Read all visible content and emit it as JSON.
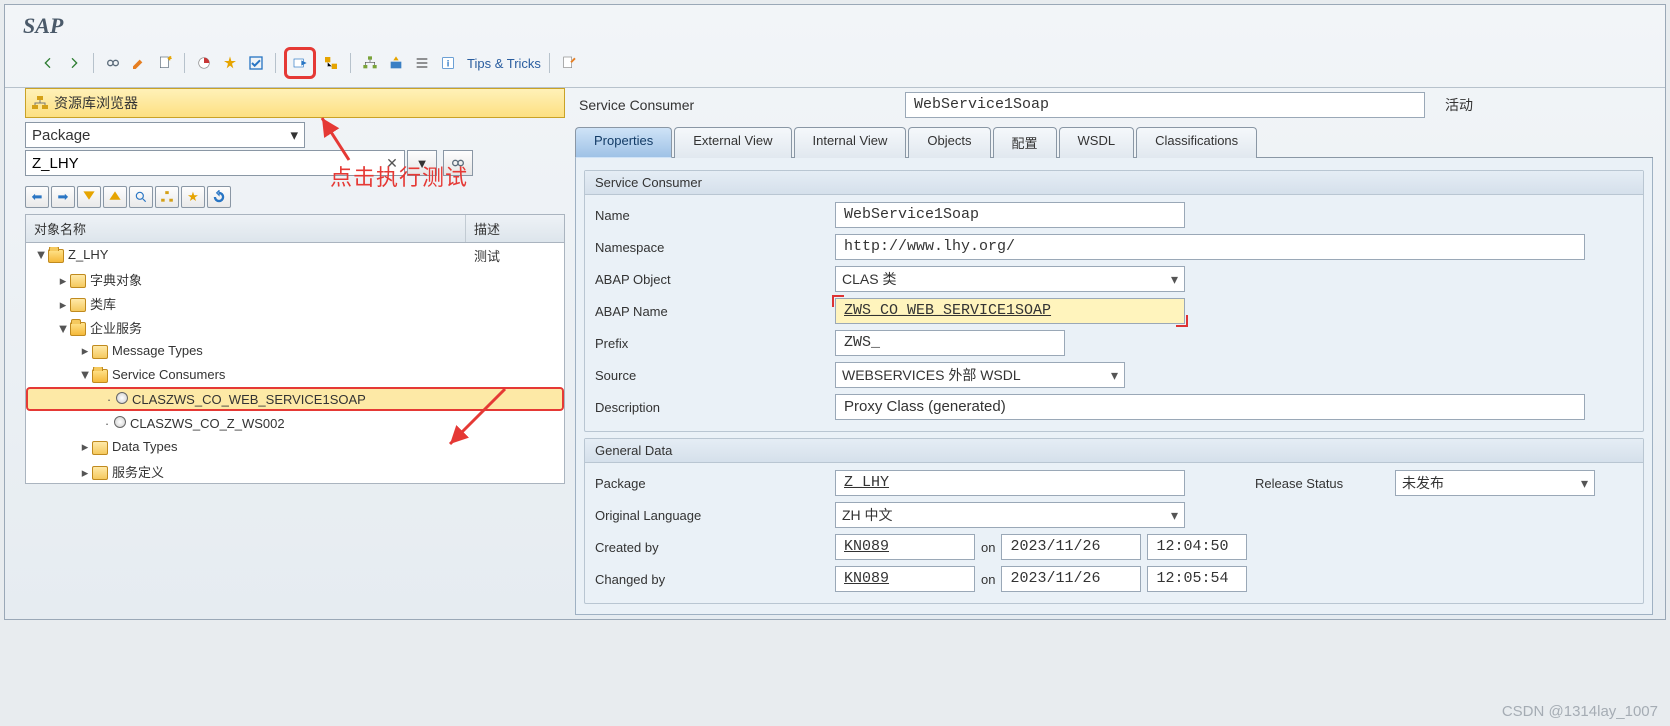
{
  "app_title": "SAP",
  "toolbar": {
    "tips_label": "Tips & Tricks"
  },
  "annotations": {
    "execute_test_note": "点击执行测试"
  },
  "left": {
    "browser_title": "资源库浏览器",
    "type_select": "Package",
    "object_input": "Z_LHY",
    "columns": {
      "name": "对象名称",
      "desc": "描述"
    },
    "tree": [
      {
        "level": 0,
        "expand": "▼",
        "icon": "folder-open",
        "label": "Z_LHY",
        "desc": "测试"
      },
      {
        "level": 1,
        "expand": "▸",
        "icon": "folder-closed",
        "label": "字典对象",
        "desc": ""
      },
      {
        "level": 1,
        "expand": "▸",
        "icon": "folder-closed",
        "label": "类库",
        "desc": ""
      },
      {
        "level": 1,
        "expand": "▼",
        "icon": "folder-open",
        "label": "企业服务",
        "desc": ""
      },
      {
        "level": 2,
        "expand": "▸",
        "icon": "folder-closed",
        "label": "Message Types",
        "desc": ""
      },
      {
        "level": 2,
        "expand": "▼",
        "icon": "folder-open",
        "label": "Service Consumers",
        "desc": ""
      },
      {
        "level": 3,
        "expand": "·",
        "icon": "dot",
        "label": "CLASZWS_CO_WEB_SERVICE1SOAP",
        "desc": "",
        "selected": true
      },
      {
        "level": 3,
        "expand": "·",
        "icon": "dot",
        "label": "CLASZWS_CO_Z_WS002",
        "desc": ""
      },
      {
        "level": 2,
        "expand": "▸",
        "icon": "folder-closed",
        "label": "Data Types",
        "desc": ""
      },
      {
        "level": 2,
        "expand": "▸",
        "icon": "folder-closed",
        "label": "服务定义",
        "desc": ""
      }
    ]
  },
  "right": {
    "header_label": "Service Consumer",
    "header_value": "WebService1Soap",
    "status": "活动",
    "tabs": [
      "Properties",
      "External View",
      "Internal View",
      "Objects",
      "配置",
      "WSDL",
      "Classifications"
    ],
    "active_tab": 0,
    "group1": {
      "title": "Service Consumer",
      "name_label": "Name",
      "name_value": "WebService1Soap",
      "ns_label": "Namespace",
      "ns_value": "http://www.lhy.org/",
      "abap_obj_label": "ABAP Object",
      "abap_obj_value": "CLAS 类",
      "abap_name_label": "ABAP Name",
      "abap_name_value": "ZWS_CO_WEB_SERVICE1SOAP",
      "prefix_label": "Prefix",
      "prefix_value": "ZWS_",
      "source_label": "Source",
      "source_value": "WEBSERVICES 外部 WSDL",
      "desc_label": "Description",
      "desc_value": "Proxy Class (generated)"
    },
    "group2": {
      "title": "General Data",
      "package_label": "Package",
      "package_value": "Z_LHY",
      "release_label": "Release Status",
      "release_value": "未发布",
      "lang_label": "Original Language",
      "lang_value": "ZH 中文",
      "created_label": "Created by",
      "created_user": "KN089",
      "on": "on",
      "created_date": "2023/11/26",
      "created_time": "12:04:50",
      "changed_label": "Changed by",
      "changed_user": "KN089",
      "changed_date": "2023/11/26",
      "changed_time": "12:05:54"
    }
  },
  "watermark": "CSDN @1314lay_1007"
}
